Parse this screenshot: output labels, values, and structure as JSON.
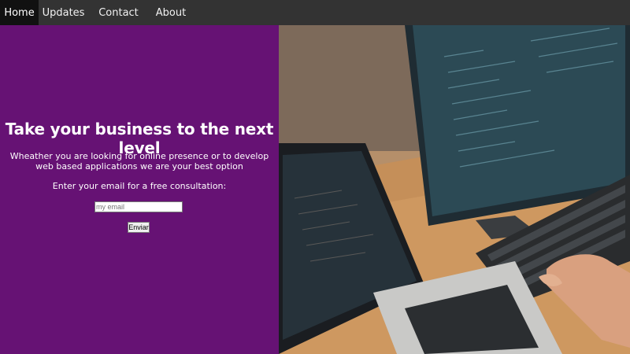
{
  "nav": {
    "items": [
      {
        "label": "Home",
        "active": true
      },
      {
        "label": "Updates",
        "active": false
      },
      {
        "label": "Contact",
        "active": false
      },
      {
        "label": "About",
        "active": false
      }
    ]
  },
  "hero": {
    "headline": "Take your business to the next level",
    "subtext": "Wheather you are looking for online presence or to develop web based applications we are your best option",
    "email_prompt": "Enter your email for a free consultation:",
    "email_placeholder": "my email",
    "email_value": "",
    "submit_label": "Enviar"
  },
  "colors": {
    "nav_bg": "#333333",
    "nav_active_bg": "#111111",
    "hero_bg": "#661274",
    "text": "#ffffff"
  },
  "image": {
    "subject": "hands-typing-on-keyboard-photo",
    "icon": "photo-icon"
  }
}
